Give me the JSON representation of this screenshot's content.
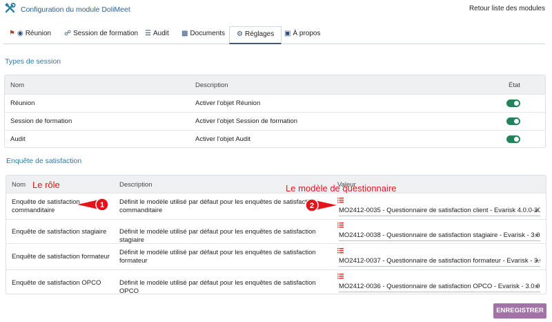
{
  "header": {
    "title": "Configuration du module DoliMeet",
    "back_link": "Retour liste des modules"
  },
  "tabs": [
    {
      "label": "Réunion"
    },
    {
      "label": "Session de formation"
    },
    {
      "label": "Audit"
    },
    {
      "label": "Documents"
    },
    {
      "label": "Réglages"
    },
    {
      "label": "À propos"
    }
  ],
  "session_types": {
    "section_title": "Types de session",
    "columns": {
      "name": "Nom",
      "description": "Description",
      "state": "État"
    },
    "rows": [
      {
        "name": "Réunion",
        "description": "Activer l'objet Réunion",
        "enabled": true
      },
      {
        "name": "Session de formation",
        "description": "Activer l'objet Session de formation",
        "enabled": true
      },
      {
        "name": "Audit",
        "description": "Activer l'objet Audit",
        "enabled": true
      }
    ]
  },
  "survey": {
    "section_title": "Enquête de satisfaction",
    "columns": {
      "name": "Nom",
      "description": "Description",
      "value": "Valeur"
    },
    "rows": [
      {
        "name": "Enquête de satisfaction commanditaire",
        "description": "Définit le modèle utilisé par défaut pour les enquêtes de satisfaction commanditaire",
        "value": "MO2412-0035 - Questionnaire de satisfaction client - Evarisk 4.0.0-20..."
      },
      {
        "name": "Enquête de satisfaction stagiaire",
        "description": "Définit le modèle utilisé par défaut pour les enquêtes de satisfaction stagiaire",
        "value": "MO2412-0038 - Questionnaire de satisfaction stagiaire - Evarisk - 3.0...."
      },
      {
        "name": "Enquête de satisfaction formateur",
        "description": "Définit le modèle utilisé par défaut pour les enquêtes de satisfaction formateur",
        "value": "MO2412-0037 - Questionnaire de satisfaction formateur - Evarisk - 3.0...."
      },
      {
        "name": "Enquête de satisfaction OPCO",
        "description": "Définit le modèle utilisé par défaut pour les enquêtes de satisfaction OPCO",
        "value": "MO2412-0036 - Questionnaire de satisfaction OPCO - Evarisk - 3.0.0-..."
      }
    ]
  },
  "annotations": {
    "role_label": "Le rôle",
    "role_number": "1",
    "model_label": "Le modèle de questionnaire",
    "model_number": "2"
  },
  "actions": {
    "save": "ENREGISTRER"
  },
  "colors": {
    "toggle_on": "#23845b",
    "accent": "#2d7aa6",
    "save_button": "#a373a8",
    "annotation": "#e5141b"
  }
}
